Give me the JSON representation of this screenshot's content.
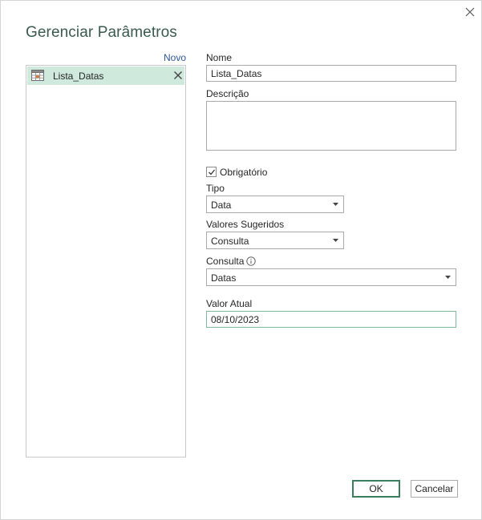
{
  "dialog": {
    "title": "Gerenciar Parâmetros",
    "close_icon": "close-icon"
  },
  "list": {
    "new_label": "Novo",
    "items": [
      {
        "label": "Lista_Datas",
        "icon": "table-icon",
        "delete_icon": "delete-x-icon",
        "selected": true
      }
    ]
  },
  "form": {
    "name": {
      "label": "Nome",
      "value": "Lista_Datas"
    },
    "description": {
      "label": "Descrição",
      "value": ""
    },
    "required": {
      "label": "Obrigatório",
      "checked": true
    },
    "type": {
      "label": "Tipo",
      "value": "Data"
    },
    "suggested_values": {
      "label": "Valores Sugeridos",
      "value": "Consulta"
    },
    "query": {
      "label": "Consulta",
      "value": "Datas",
      "info_icon": "info-icon"
    },
    "current_value": {
      "label": "Valor Atual",
      "value": "08/10/2023"
    }
  },
  "buttons": {
    "ok_label": "OK",
    "cancel_label": "Cancelar"
  },
  "colors": {
    "title": "#3a5a4f",
    "selected_item_bg": "#cfe9dc",
    "link": "#2b579a",
    "ok_border": "#3a7e5e",
    "focused_input_border": "#7fb89a"
  }
}
